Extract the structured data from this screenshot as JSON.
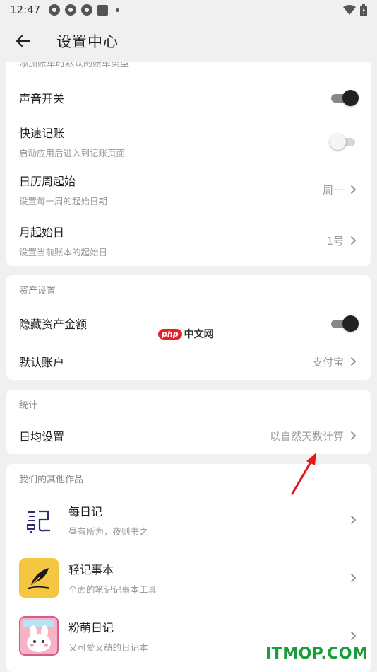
{
  "status": {
    "time": "12:47"
  },
  "appbar": {
    "title": "设置中心"
  },
  "card1": {
    "cut_text": "添加账单时默认的账单类型",
    "sound": {
      "title": "声音开关",
      "enabled": true
    },
    "quick": {
      "title": "快速记账",
      "sub": "启动应用后进入到记账页面",
      "enabled": false
    },
    "calendar": {
      "title": "日历周起始",
      "sub": "设置每一周的起始日期",
      "value": "周一"
    },
    "month": {
      "title": "月起始日",
      "sub": "设置当前账本的起始日",
      "value": "1号"
    }
  },
  "card2": {
    "head": "资产设置",
    "hide": {
      "title": "隐藏资产金额",
      "enabled": true
    },
    "default_account": {
      "title": "默认账户",
      "value": "支付宝"
    }
  },
  "card3": {
    "head": "统计",
    "daily": {
      "title": "日均设置",
      "value": "以自然天数计算"
    }
  },
  "card4": {
    "head": "我们的其他作品",
    "apps": [
      {
        "title": "每日记",
        "sub": "昼有所为，夜则书之",
        "icon": "meiriji-icon"
      },
      {
        "title": "轻记事本",
        "sub": "全面的笔记记事本工具",
        "icon": "feather-icon"
      },
      {
        "title": "粉萌日记",
        "sub": "又可爱又萌的日记本",
        "icon": "fenmeng-icon"
      }
    ]
  },
  "watermarks": {
    "php_badge": "php",
    "php_text": "中文网",
    "itmop": "ITMOP.COM"
  },
  "colors": {
    "toggle_on": "#222222",
    "background": "#f0f0f0",
    "watermark_green": "#1a9c3a",
    "arrow_red": "#e01818"
  }
}
